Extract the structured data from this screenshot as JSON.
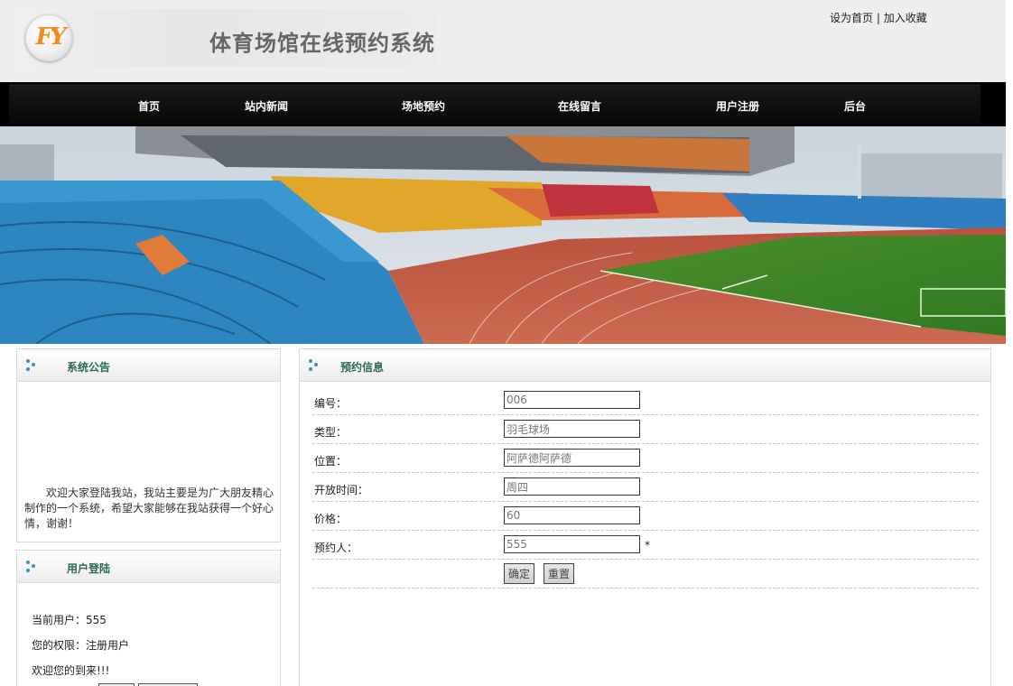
{
  "header": {
    "logo_text": "FY",
    "site_title": "体育场馆在线预约系统",
    "set_home": "设为首页",
    "separator": "|",
    "add_favorite": "加入收藏"
  },
  "nav": {
    "items": [
      {
        "label": "首页"
      },
      {
        "label": "站内新闻"
      },
      {
        "label": "场地预约"
      },
      {
        "label": "在线留言"
      },
      {
        "label": "用户注册"
      },
      {
        "label": "后台"
      }
    ]
  },
  "notice": {
    "title": "系统公告",
    "text": "欢迎大家登陆我站，我站主要是为广大朋友精心制作的一个系统，希望大家能够在我站获得一个好心情，谢谢！"
  },
  "login": {
    "title": "用户登陆",
    "current_user": "当前用户：555",
    "permission": "您的权限：注册用户",
    "welcome": "欢迎您的到来!!!"
  },
  "booking": {
    "title": "预约信息",
    "fields": [
      {
        "label": "编号：",
        "value": "006"
      },
      {
        "label": "类型：",
        "value": "羽毛球场"
      },
      {
        "label": "位置：",
        "value": "阿萨德阿萨德"
      },
      {
        "label": "开放时间：",
        "value": "周四"
      },
      {
        "label": "价格：",
        "value": "60"
      },
      {
        "label": "预约人：",
        "value": "555"
      }
    ],
    "required_mark": "*",
    "submit_label": "确定",
    "reset_label": "重置"
  }
}
